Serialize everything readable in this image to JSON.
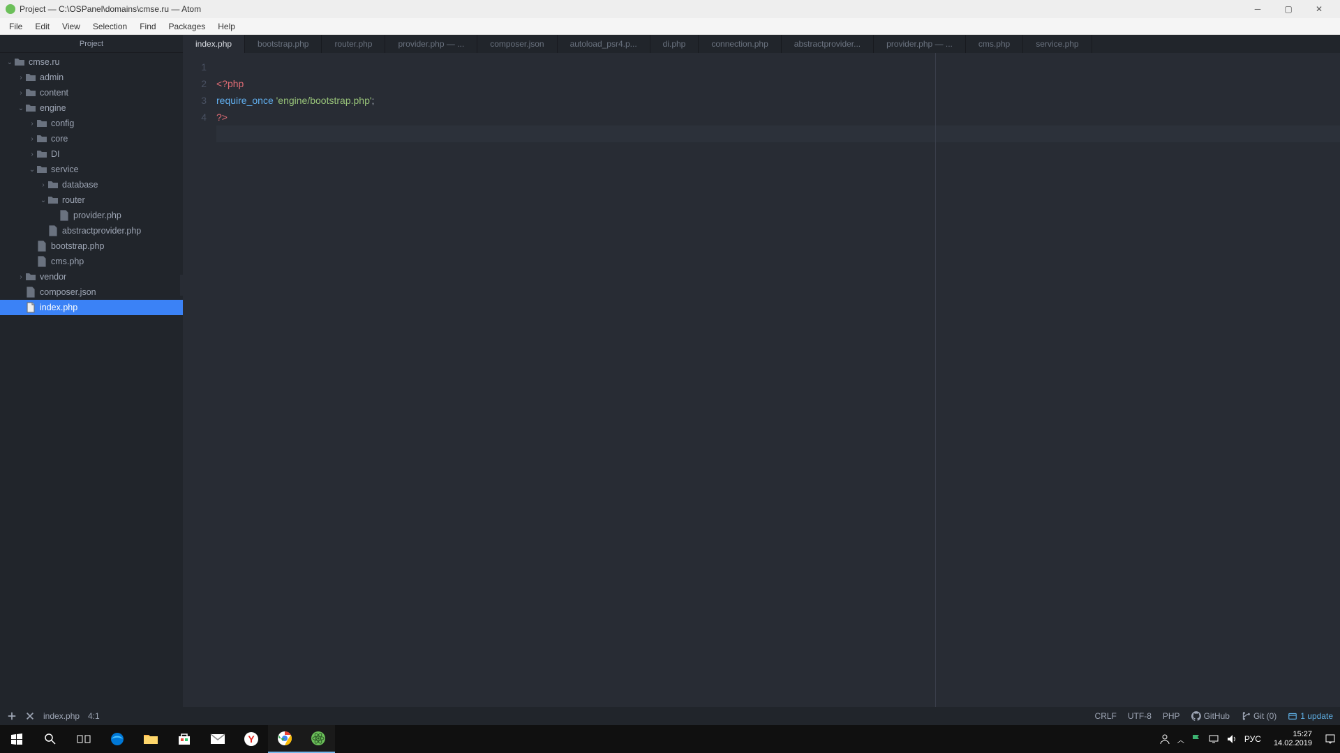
{
  "window": {
    "title": "Project — C:\\OSPanel\\domains\\cmse.ru — Atom"
  },
  "menu": [
    "File",
    "Edit",
    "View",
    "Selection",
    "Find",
    "Packages",
    "Help"
  ],
  "sidebar": {
    "title": "Project",
    "tree": [
      {
        "depth": 0,
        "kind": "folder",
        "open": true,
        "label": "cmse.ru"
      },
      {
        "depth": 1,
        "kind": "folder",
        "open": false,
        "label": "admin"
      },
      {
        "depth": 1,
        "kind": "folder",
        "open": false,
        "label": "content"
      },
      {
        "depth": 1,
        "kind": "folder",
        "open": true,
        "label": "engine"
      },
      {
        "depth": 2,
        "kind": "folder",
        "open": false,
        "label": "config"
      },
      {
        "depth": 2,
        "kind": "folder",
        "open": false,
        "label": "core"
      },
      {
        "depth": 2,
        "kind": "folder",
        "open": false,
        "label": "DI"
      },
      {
        "depth": 2,
        "kind": "folder",
        "open": true,
        "label": "service"
      },
      {
        "depth": 3,
        "kind": "folder",
        "open": false,
        "label": "database"
      },
      {
        "depth": 3,
        "kind": "folder",
        "open": true,
        "label": "router"
      },
      {
        "depth": 4,
        "kind": "file",
        "label": "provider.php"
      },
      {
        "depth": 3,
        "kind": "file",
        "label": "abstractprovider.php"
      },
      {
        "depth": 2,
        "kind": "file",
        "label": "bootstrap.php"
      },
      {
        "depth": 2,
        "kind": "file",
        "label": "cms.php"
      },
      {
        "depth": 1,
        "kind": "folder",
        "open": false,
        "label": "vendor"
      },
      {
        "depth": 1,
        "kind": "file",
        "label": "composer.json"
      },
      {
        "depth": 1,
        "kind": "file",
        "label": "index.php",
        "selected": true
      }
    ]
  },
  "tabs": [
    {
      "label": "index.php",
      "active": true
    },
    {
      "label": "bootstrap.php"
    },
    {
      "label": "router.php"
    },
    {
      "label": "provider.php — ..."
    },
    {
      "label": "composer.json"
    },
    {
      "label": "autoload_psr4.p..."
    },
    {
      "label": "di.php"
    },
    {
      "label": "connection.php"
    },
    {
      "label": "abstractprovider..."
    },
    {
      "label": "provider.php — ..."
    },
    {
      "label": "cms.php"
    },
    {
      "label": "service.php"
    }
  ],
  "code": {
    "line1_open": "<?php",
    "line2_func": "require_once",
    "line2_sp": " ",
    "line2_str": "'engine/bootstrap.php'",
    "line2_end": ";",
    "line3_close": "?>",
    "gutters": [
      "1",
      "2",
      "3",
      "4"
    ]
  },
  "status": {
    "file": "index.php",
    "cursor": "4:1",
    "crlf": "CRLF",
    "encoding": "UTF-8",
    "lang": "PHP",
    "github": "GitHub",
    "git": "Git (0)",
    "updates": "1 update"
  },
  "tray": {
    "lang": "РУС",
    "time": "15:27",
    "date": "14.02.2019"
  }
}
